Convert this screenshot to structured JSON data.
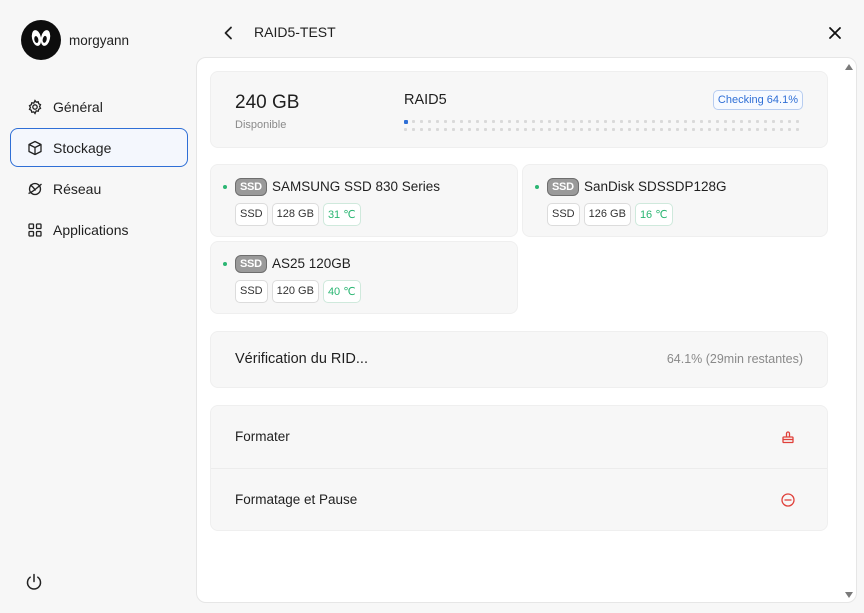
{
  "user": {
    "name": "morgyann"
  },
  "nav": {
    "items": [
      {
        "label": "Général",
        "icon": "gear-icon"
      },
      {
        "label": "Stockage",
        "icon": "cube-icon",
        "active": true
      },
      {
        "label": "Réseau",
        "icon": "globe-icon"
      },
      {
        "label": "Applications",
        "icon": "grid-icon"
      }
    ]
  },
  "header": {
    "title": "RAID5-TEST"
  },
  "summary": {
    "capacity": "240 GB",
    "capacity_label": "Disponible",
    "raid_type": "RAID5",
    "status_badge": "Checking 64.1%",
    "progress_fraction": 0.02
  },
  "disks": [
    {
      "badge": "SSD",
      "name": "SAMSUNG SSD 830 Series",
      "type": "SSD",
      "size": "128 GB",
      "temp": "31 ℃"
    },
    {
      "badge": "SSD",
      "name": "SanDisk SDSSDP128G",
      "type": "SSD",
      "size": "126 GB",
      "temp": "16 ℃"
    },
    {
      "badge": "SSD",
      "name": "AS25 120GB",
      "type": "SSD",
      "size": "120 GB",
      "temp": "40 ℃"
    }
  ],
  "verification": {
    "title": "Vérification du RID...",
    "progress": "64.1% (29min restantes)"
  },
  "actions": {
    "format": "Formater",
    "format_pause": "Formatage et Pause"
  },
  "colors": {
    "accent": "#2f6fd6",
    "danger": "#e0403a",
    "ok": "#2bb673"
  }
}
